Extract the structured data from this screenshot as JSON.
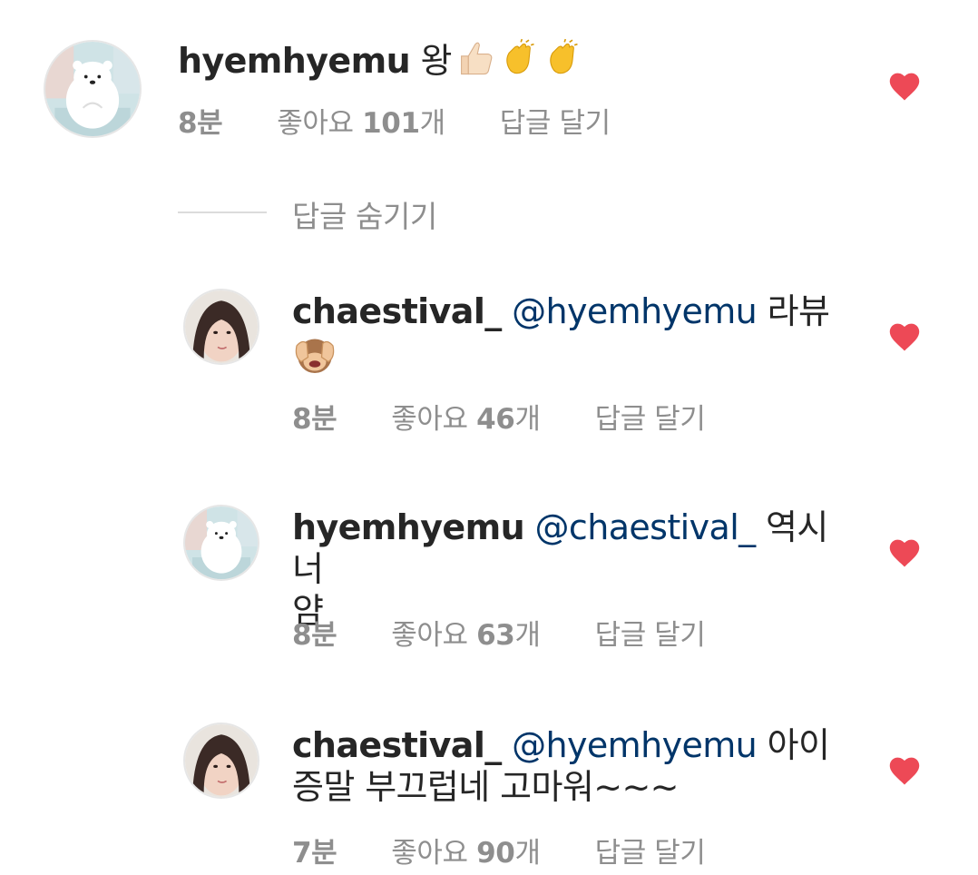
{
  "comments": [
    {
      "username": "hyemhyemu",
      "mention": "",
      "text_line1": " 왕",
      "text_line2": "",
      "emoji": [
        "thumbs-up-light",
        "clap",
        "clap"
      ],
      "time": "8분",
      "likes_prefix": "좋아요 ",
      "likes": "101",
      "likes_suffix": "개",
      "reply": "답글 달기"
    },
    {
      "username": "chaestival_",
      "mention": "@hyemhyemu",
      "text_line1": " 라뷰",
      "text_line2": "",
      "emoji": [
        "see-no-evil-monkey"
      ],
      "time": "8분",
      "likes_prefix": "좋아요 ",
      "likes": "46",
      "likes_suffix": "개",
      "reply": "답글 달기"
    },
    {
      "username": "hyemhyemu",
      "mention": "@chaestival_",
      "text_line1": " 역시너",
      "text_line2": "얌",
      "emoji": [],
      "time": "8분",
      "likes_prefix": "좋아요 ",
      "likes": "63",
      "likes_suffix": "개",
      "reply": "답글 달기"
    },
    {
      "username": "chaestival_",
      "mention": "@hyemhyemu",
      "text_line1": " 아이",
      "text_line2": "증말 부끄럽네 고마워~~~",
      "emoji": [],
      "time": "7분",
      "likes_prefix": "좋아요 ",
      "likes": "90",
      "likes_suffix": "개",
      "reply": "답글 달기"
    }
  ],
  "hide_replies_label": "답글 숨기기",
  "colors": {
    "heart": "#ed4956",
    "meta": "#8e8e8e",
    "mention": "#003569",
    "text": "#262626"
  }
}
